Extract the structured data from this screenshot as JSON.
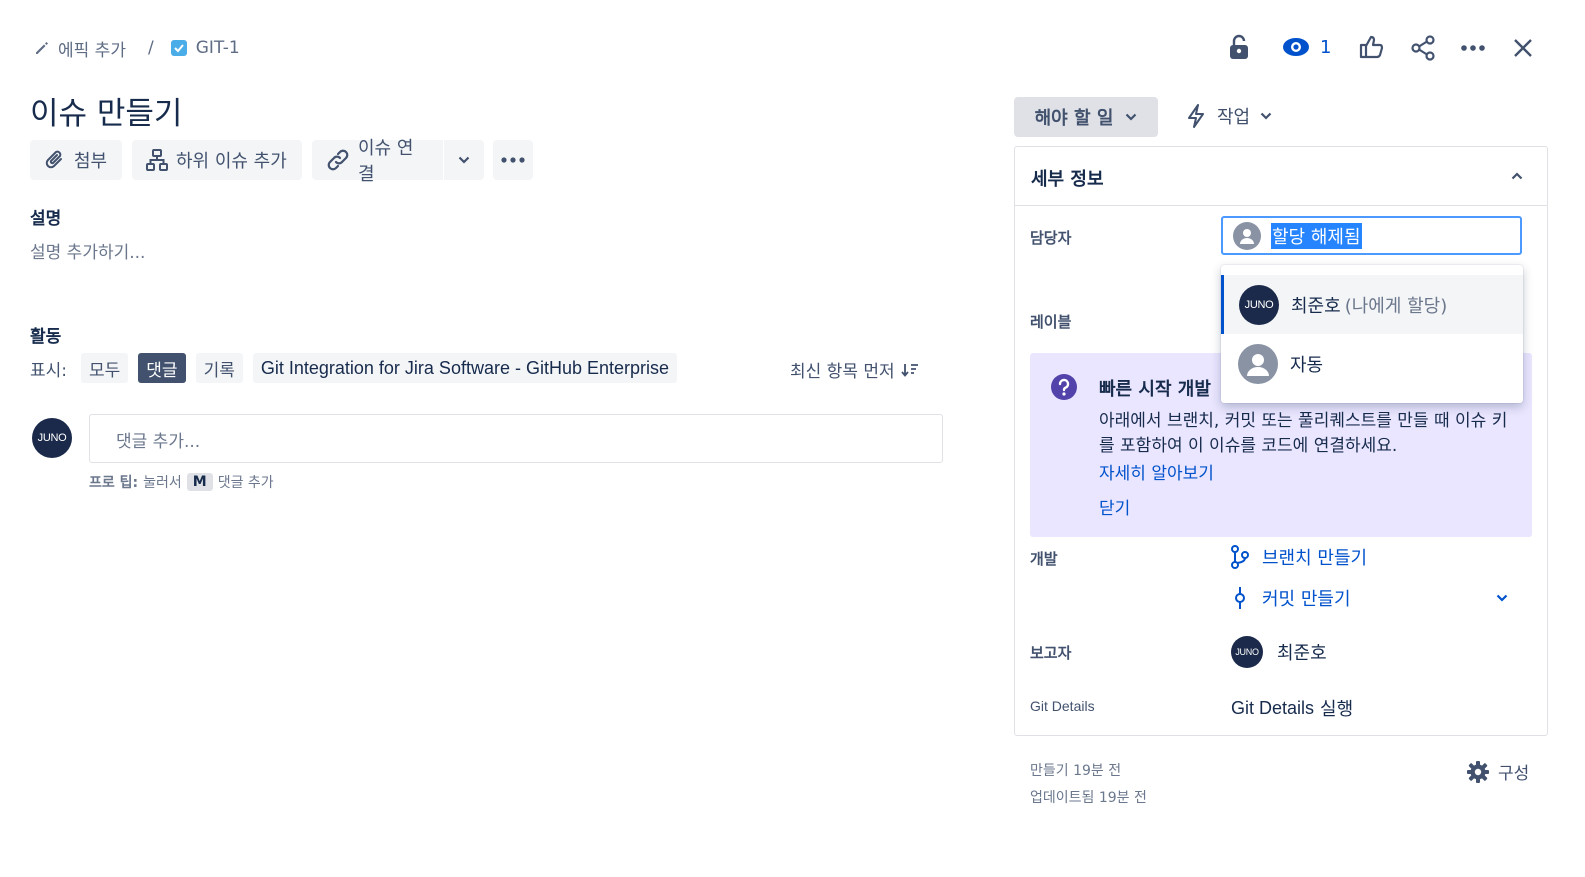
{
  "breadcrumb": {
    "epic_label": "에픽 추가",
    "separator": "/",
    "issue_key": "GIT-1"
  },
  "header_actions": {
    "watch_count": "1"
  },
  "issue": {
    "title": "이슈 만들기"
  },
  "toolbar": {
    "attach_label": "첨부",
    "subtask_label": "하위 이슈 추가",
    "link_label": "이슈 연결"
  },
  "description": {
    "heading": "설명",
    "placeholder": "설명 추가하기..."
  },
  "activity": {
    "heading": "활동",
    "show_label": "표시:",
    "filters": [
      "모두",
      "댓글",
      "기록",
      "Git Integration for Jira Software - GitHub Enterprise"
    ],
    "active_filter_index": 1,
    "sort_label": "최신 항목 먼저",
    "comment_placeholder": "댓글 추가...",
    "avatar_initials": "JUNO",
    "tip_prefix": "프로 팁:",
    "tip_middle": "눌러서",
    "tip_key": "M",
    "tip_suffix": "댓글 추가"
  },
  "status": {
    "current": "해야 할 일",
    "action_label": "작업"
  },
  "details": {
    "heading": "세부 정보",
    "assignee_label": "담당자",
    "assignee_value": "할당 해제됨",
    "labels_label": "레이블",
    "dropdown": [
      {
        "name": "최준호",
        "note": "(나에게 할당)",
        "avatar": "JUNO"
      },
      {
        "name": "자동",
        "note": "",
        "avatar": ""
      }
    ],
    "quickstart": {
      "title": "빠른 시작 개발",
      "body": "아래에서 브랜치, 커밋 또는 풀리퀘스트를 만들 때 이슈 키를 포함하여 이 이슈를 코드에 연결하세요.",
      "learn_more": "자세히 알아보기",
      "dismiss": "닫기"
    },
    "development_label": "개발",
    "create_branch": "브랜치 만들기",
    "create_commit": "커밋 만들기",
    "reporter_label": "보고자",
    "reporter_name": "최준호",
    "reporter_avatar": "JUNO",
    "git_details_label": "Git Details",
    "git_details_value_bold": "Git Details",
    "git_details_value_rest": "실행"
  },
  "footer": {
    "created": "만들기 19분 전",
    "updated": "업데이트됨 19분 전",
    "configure": "구성"
  },
  "colors": {
    "primary_blue": "#0052cc",
    "quickstart_bg": "#eae6ff",
    "quickstart_icon": "#5243aa",
    "selected_text_bg": "#2684ff"
  }
}
